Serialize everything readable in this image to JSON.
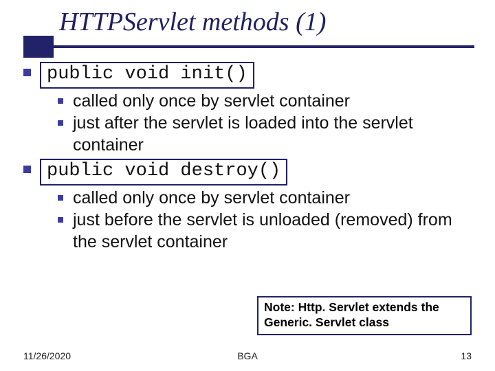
{
  "title": "HTTPServlet methods (1)",
  "items": [
    {
      "code": "public void init()",
      "sub": [
        "called only once by servlet container",
        "just after the servlet is loaded into the servlet container"
      ]
    },
    {
      "code": "public void destroy()",
      "sub": [
        "called only once by servlet container",
        "just before the servlet is unloaded (removed) from the servlet container"
      ]
    }
  ],
  "note": "Note: Http. Servlet extends the Generic. Servlet class",
  "footer": {
    "date": "11/26/2020",
    "center": "BGA",
    "page": "13"
  }
}
